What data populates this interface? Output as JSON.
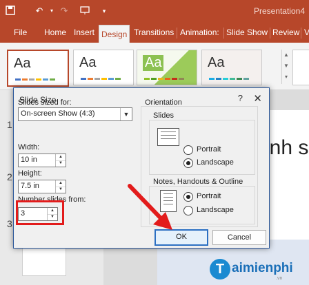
{
  "app": {
    "title": "Presentation4",
    "quick_access": [
      "save-icon",
      "undo-icon",
      "redo-icon",
      "present-from-start-icon",
      "customize-dropdown-icon"
    ]
  },
  "ribbon": {
    "tabs": [
      "File",
      "Home",
      "Insert",
      "Design",
      "Transitions",
      "Animation:",
      "Slide Show",
      "Review",
      "V"
    ],
    "active_tab": "Design",
    "theme_label": "Aa"
  },
  "thumbnails": {
    "numbers": [
      "1",
      "2",
      "3"
    ]
  },
  "slide": {
    "text": "ánh s"
  },
  "dialog": {
    "title": "Slide Size",
    "help": "?",
    "close": "✕",
    "sized_for_label": "Slides sized for:",
    "sized_for_value": "On-screen Show (4:3)",
    "width_label": "Width:",
    "width_value": "10 in",
    "height_label": "Height:",
    "height_value": "7.5 in",
    "number_from_label": "Number slides from:",
    "number_from_value": "3",
    "orientation_label": "Orientation",
    "slides_label": "Slides",
    "notes_label": "Notes, Handouts & Outline",
    "portrait": "Portrait",
    "landscape": "Landscape",
    "slides_orientation": "Landscape",
    "notes_orientation": "Portrait",
    "ok": "OK",
    "cancel": "Cancel"
  },
  "watermark": {
    "brand": "aimienphi",
    "suffix": ".vn",
    "letter": "T"
  },
  "colors": {
    "accent": "#b7472a",
    "highlight": "#e21b1b",
    "dialog_border": "#2b579a"
  }
}
